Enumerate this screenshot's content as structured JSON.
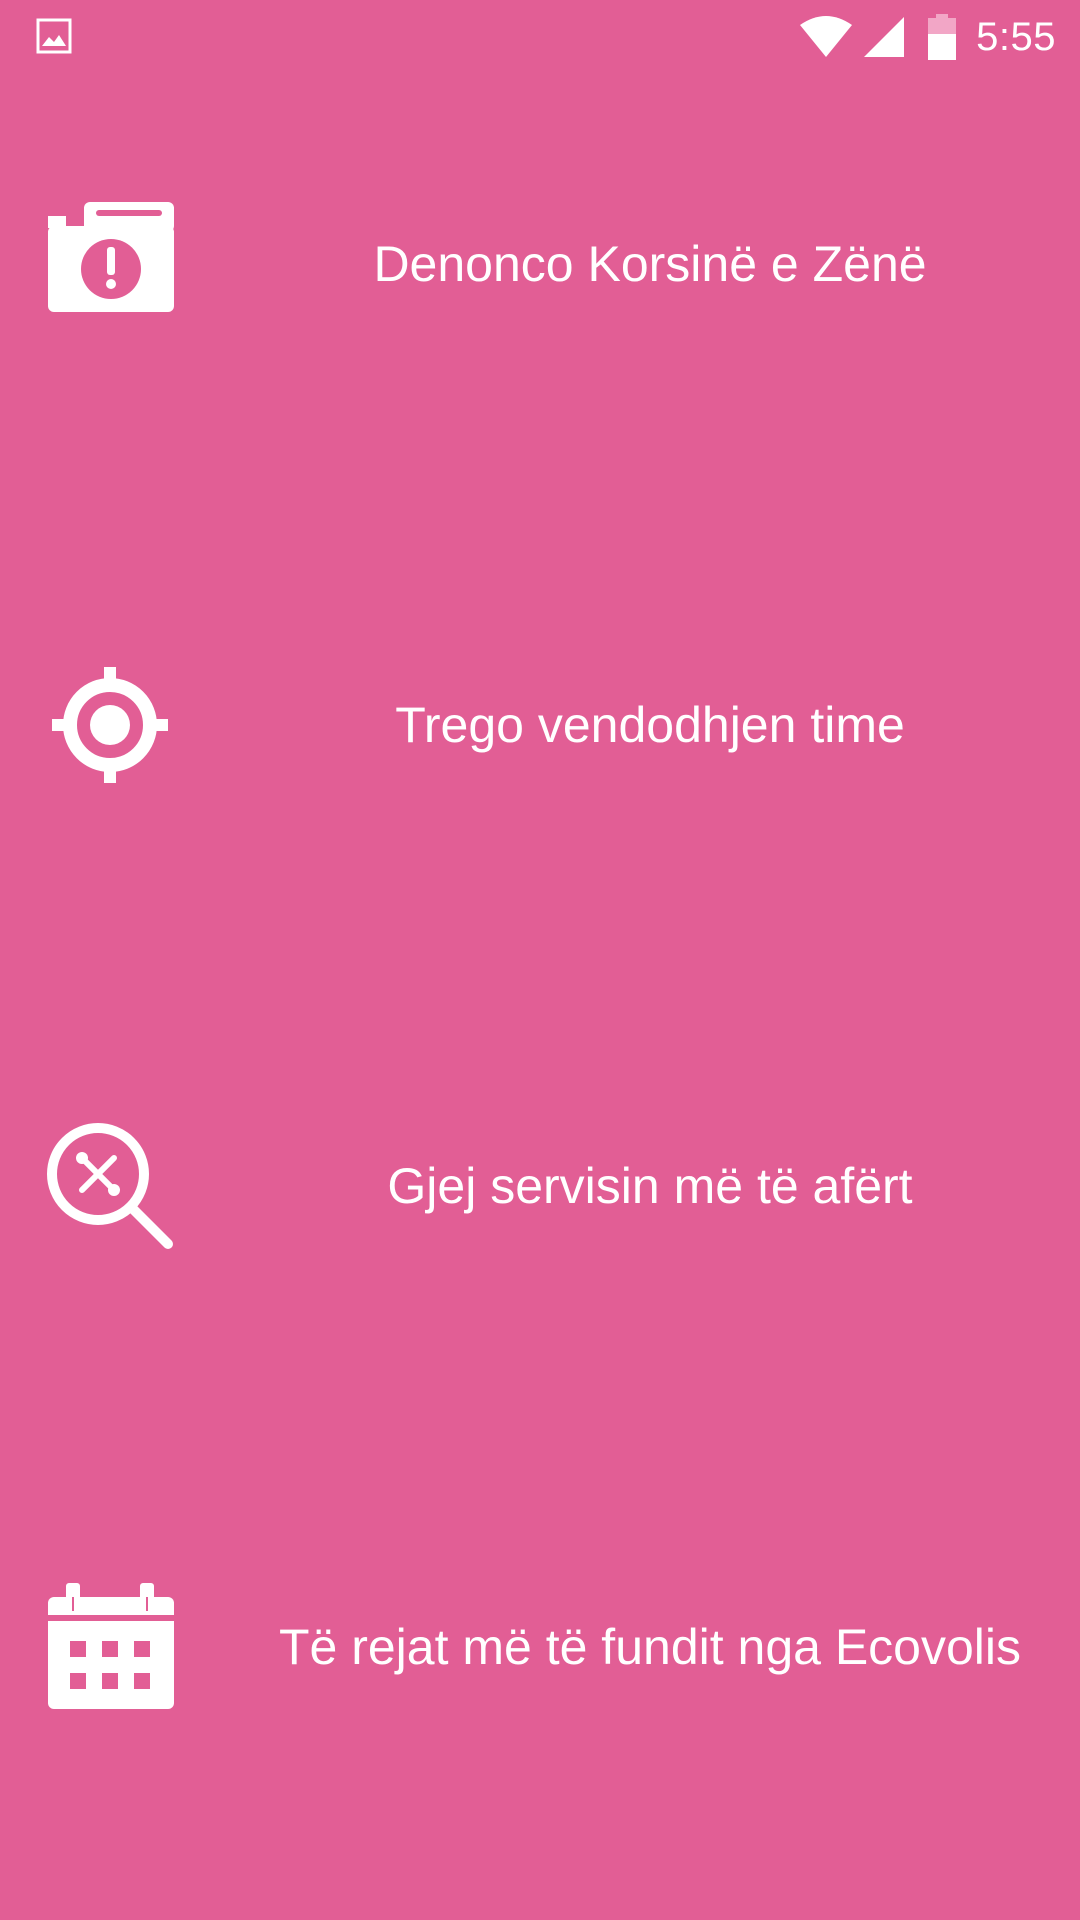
{
  "status_bar": {
    "time": "5:55",
    "icons": [
      "gallery-icon",
      "wifi-icon",
      "cell-signal-icon",
      "battery-icon"
    ]
  },
  "menu": {
    "items": [
      {
        "icon": "camera-alert-icon",
        "label": "Denonco Korsinë e Zënë"
      },
      {
        "icon": "crosshair-location-icon",
        "label": "Trego vendodhjen time"
      },
      {
        "icon": "search-service-icon",
        "label": "Gjej servisin më të afërt"
      },
      {
        "icon": "calendar-icon",
        "label": "Të rejat më të fundit nga Ecovolis"
      }
    ]
  },
  "colors": {
    "background": "#E25E95",
    "foreground": "#FFFFFF"
  }
}
